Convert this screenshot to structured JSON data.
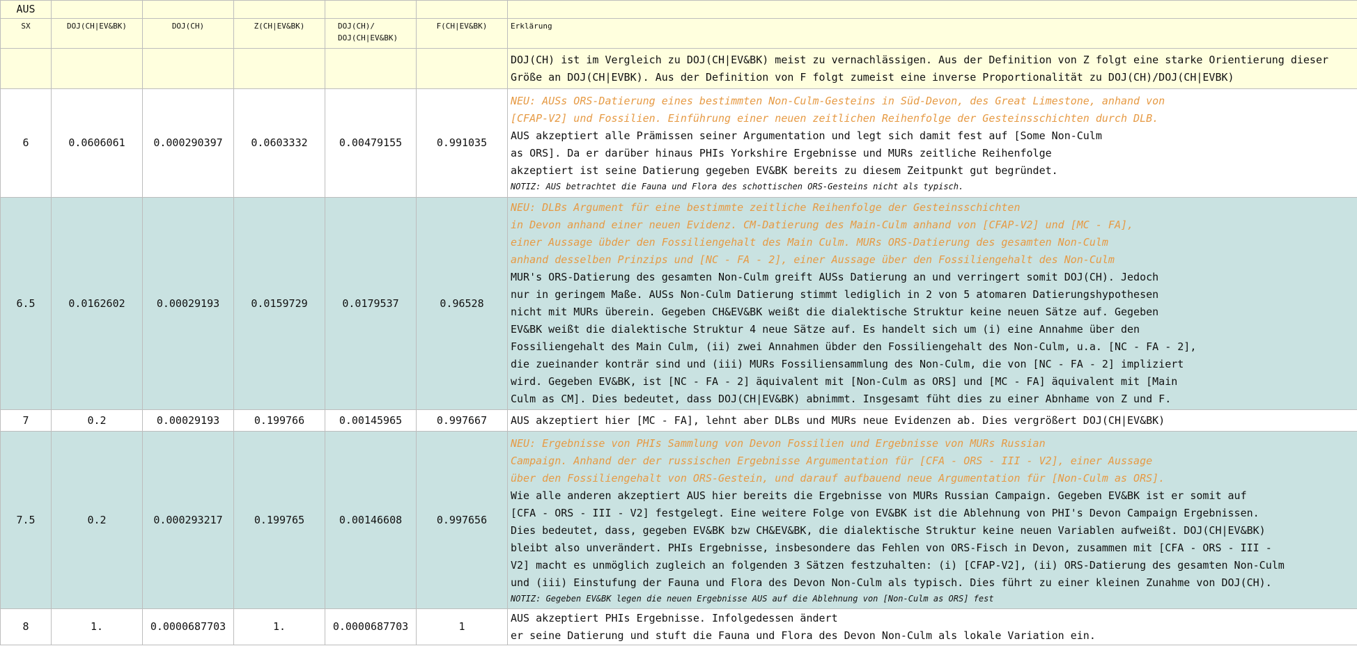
{
  "title": "AUS",
  "headers": [
    "SX",
    "DOJ(CH|EV&BK)",
    "DOJ(CH)",
    "Z(CH|EV&BK)",
    "DOJ(CH)/\nDOJ(CH|EV&BK)",
    "F(CH|EV&BK)",
    "Erklärung"
  ],
  "intro": "DOJ(CH) ist im Vergleich zu DOJ(CH|EV&BK) meist zu vernachlässigen. Aus der Definition von Z folgt eine starke Orientierung dieser Größe an DOJ(CH|EVBK). Aus der Definition von F folgt zumeist eine inverse Proportionalität zu DOJ(CH)/DOJ(CH|EVBK)",
  "rows": [
    {
      "sx": "6",
      "doj_chevbk": "0.0606061",
      "doj_ch": "0.000290397",
      "z": "0.0603332",
      "ratio": "0.00479155",
      "f": "0.991035",
      "new": "NEU: AUSs ORS-Datierung eines bestimmten Non-Culm-Gesteins in Süd-Devon, des Great Limestone, anhand von\n[CFAP-V2] und Fossilien. Einführung einer neuen zeitlichen Reihenfolge der Gesteinsschichten durch DLB.",
      "text": "AUS akzeptiert alle Prämissen seiner Argumentation und legt sich damit fest auf [Some Non-Culm\nas ORS]. Da er darüber hinaus PHIs Yorkshire Ergebnisse und MURs zeitliche Reihenfolge\nakzeptiert ist seine Datierung gegeben EV&BK bereits zu diesem Zeitpunkt gut begründet.",
      "note": "NOTIZ: AUS betrachtet die Fauna und Flora des schottischen ORS-Gesteins nicht als typisch."
    },
    {
      "sx": "6.5",
      "doj_chevbk": "0.0162602",
      "doj_ch": "0.00029193",
      "z": "0.0159729",
      "ratio": "0.0179537",
      "f": "0.96528",
      "new": "NEU: DLBs Argument für eine bestimmte zeitliche Reihenfolge der Gesteinsschichten\nin Devon anhand einer neuen Evidenz. CM-Datierung des Main-Culm anhand von [CFAP-V2] und [MC - FA],\neiner Aussage übder den Fossiliengehalt des Main Culm. MURs ORS-Datierung des gesamten Non-Culm\nanhand desselben Prinzips und [NC - FA - 2], einer Aussage über den Fossiliengehalt des Non-Culm",
      "text": "MUR's ORS-Datierung des gesamten Non-Culm greift AUSs Datierung an und verringert somit DOJ(CH). Jedoch\nnur in geringem Maße. AUSs Non-Culm Datierung stimmt lediglich in 2 von 5 atomaren Datierungshypothesen\nnicht mit MURs überein. Gegeben CH&EV&BK weißt die dialektische Struktur keine neuen Sätze auf. Gegeben\nEV&BK weißt die dialektische Struktur 4 neue Sätze auf. Es handelt sich um (i) eine Annahme über den\nFossiliengehalt des Main Culm, (ii) zwei Annahmen übder den Fossiliengehalt des Non-Culm, u.a. [NC - FA - 2],\ndie zueinander konträr sind und (iii) MURs Fossiliensammlung des Non-Culm, die von [NC - FA - 2] impliziert\nwird. Gegeben EV&BK, ist [NC - FA - 2] äquivalent mit [Non-Culm as ORS] und [MC - FA] äquivalent mit [Main\nCulm as CM]. Dies bedeutet, dass DOJ(CH|EV&BK) abnimmt. Insgesamt füht dies zu einer Abnhame von Z und F.",
      "note": ""
    },
    {
      "sx": "7",
      "doj_chevbk": "0.2",
      "doj_ch": "0.00029193",
      "z": "0.199766",
      "ratio": "0.00145965",
      "f": "0.997667",
      "new": "",
      "text": "AUS akzeptiert hier [MC - FA], lehnt aber DLBs und MURs neue Evidenzen ab. Dies vergrößert DOJ(CH|EV&BK)",
      "note": ""
    },
    {
      "sx": "7.5",
      "doj_chevbk": "0.2",
      "doj_ch": "0.000293217",
      "z": "0.199765",
      "ratio": "0.00146608",
      "f": "0.997656",
      "new": "NEU: Ergebnisse von PHIs Sammlung von Devon Fossilien und Ergebnisse von MURs Russian\nCampaign. Anhand der der russischen Ergebnisse Argumentation für [CFA - ORS - III - V2], einer Aussage\nüber den Fossiliengehalt von ORS-Gestein, und darauf aufbauend neue Argumentation für [Non-Culm as ORS].",
      "text": "Wie alle anderen akzeptiert AUS hier bereits die Ergebnisse von MURs Russian Campaign. Gegeben EV&BK ist er somit auf\n[CFA - ORS - III - V2] festgelegt. Eine weitere Folge von EV&BK ist die Ablehnung von PHI's Devon Campaign Ergebnissen.\nDies bedeutet, dass, gegeben EV&BK bzw CH&EV&BK, die dialektische Struktur keine neuen Variablen aufweißt. DOJ(CH|EV&BK)\nbleibt also unverändert. PHIs Ergebnisse, insbesondere das Fehlen von ORS-Fisch in Devon, zusammen mit [CFA - ORS - III -\nV2] macht es unmöglich zugleich an folgenden 3 Sätzen festzuhalten: (i) [CFAP-V2], (ii) ORS-Datierung des gesamten Non-Culm\nund (iii) Einstufung der Fauna und Flora des Devon Non-Culm als typisch. Dies führt zu einer kleinen Zunahme von DOJ(CH).",
      "note": "NOTIZ: Gegeben EV&BK legen die neuen Ergebnisse AUS auf die Ablehnung von [Non-Culm as ORS] fest"
    },
    {
      "sx": "8",
      "doj_chevbk": "1.",
      "doj_ch": "0.0000687703",
      "z": "1.",
      "ratio": "0.0000687703",
      "f": "1",
      "new": "",
      "text": "AUS akzeptiert PHIs Ergebnisse. Infolgedessen ändert\ner seine Datierung und stuft die Fauna und Flora des Devon Non-Culm als lokale Variation ein.",
      "note": ""
    }
  ]
}
